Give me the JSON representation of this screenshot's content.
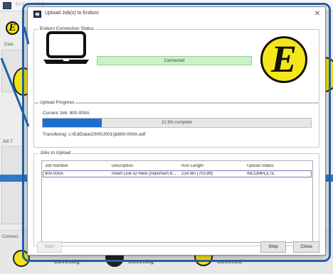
{
  "background": {
    "window_title": "Enduro 7.2.0",
    "logo_letter": "E",
    "labels": [
      "Data",
      "Job T",
      "Connect"
    ],
    "status_items": [
      "Connecting.",
      "Connecting.",
      "Connected."
    ]
  },
  "dialog": {
    "title": "Upload Job(s) to Enduro",
    "close_glyph": "✕",
    "connection": {
      "group_title": "Enduro Connection Status",
      "status_text": "Connected",
      "logo_letter": "E"
    },
    "progress": {
      "group_title": "Upload Progress",
      "current_job": "Current Job:  800-000A",
      "percent_fraction": 0.219,
      "percent_text": "21.9% complete",
      "transfer_text": "Transfering: c:\\EdiData\\2000\\J001\\jb800-000A.edf"
    },
    "jobs": {
      "group_title": "Jobs to Upload",
      "columns": [
        "Job Number",
        "Description",
        "Run Length",
        "Upload Status"
      ],
      "rows": [
        [
          "800-000A",
          "Insert Line ID Here (maximum 8...",
          "214.9m (703.9ft)",
          "INCOMPLETE"
        ]
      ]
    },
    "buttons": {
      "start": "Start",
      "stop": "Stop",
      "close": "Close"
    }
  },
  "colors": {
    "annotation_blue": "#1f5fa8",
    "progress_blue": "#1b70cf",
    "connected_green": "#c9f2c5",
    "logo_yellow": "#f5e61b"
  },
  "icons": [
    "laptop-icon",
    "enduro-logo-icon",
    "upload-dialog-icon",
    "close-icon"
  ]
}
